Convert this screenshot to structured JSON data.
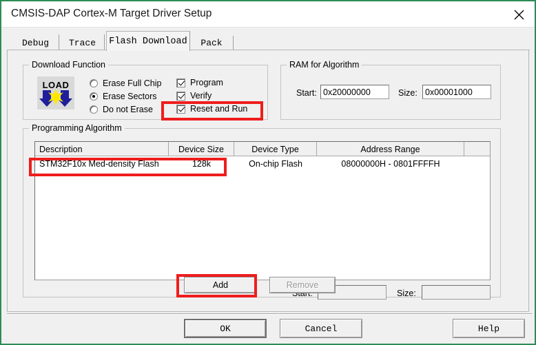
{
  "window": {
    "title": "CMSIS-DAP Cortex-M Target Driver Setup",
    "close_icon": "close-icon",
    "border_color": "#2e8b57"
  },
  "tabs": [
    {
      "label": "Debug",
      "active": false
    },
    {
      "label": "Trace",
      "active": false
    },
    {
      "label": "Flash Download",
      "active": true
    },
    {
      "label": "Pack",
      "active": false
    }
  ],
  "download_function": {
    "group_title": "Download Function",
    "icon": "load-icon",
    "erase_mode_selected": "Erase Sectors",
    "radios": [
      {
        "label": "Erase Full Chip",
        "checked": false
      },
      {
        "label": "Erase Sectors",
        "checked": true
      },
      {
        "label": "Do not Erase",
        "checked": false
      }
    ],
    "checkboxes": [
      {
        "label": "Program",
        "checked": true
      },
      {
        "label": "Verify",
        "checked": true
      },
      {
        "label": "Reset and Run",
        "checked": true
      }
    ]
  },
  "ram_for_algorithm": {
    "group_title": "RAM for Algorithm",
    "start_label": "Start:",
    "start_value": "0x20000000",
    "size_label": "Size:",
    "size_value": "0x00001000"
  },
  "programming_algorithm": {
    "group_title": "Programming Algorithm",
    "columns": [
      "Description",
      "Device Size",
      "Device Type",
      "Address Range",
      ""
    ],
    "rows": [
      {
        "description": "STM32F10x Med-density Flash",
        "device_size": "128k",
        "device_type": "On-chip Flash",
        "address_range": "08000000H - 0801FFFFH",
        "extra": ""
      }
    ],
    "start_label": "Start:",
    "start_value": "",
    "size_label": "Size:",
    "size_value": "",
    "add_label": "Add",
    "remove_label": "Remove",
    "remove_disabled": true
  },
  "dialog_buttons": {
    "ok": "OK",
    "cancel": "Cancel",
    "help": "Help"
  },
  "annotations": {
    "highlight_color": "#ef1d1d",
    "boxes": [
      {
        "name": "reset-and-run-highlight"
      },
      {
        "name": "algorithm-row-highlight"
      },
      {
        "name": "add-button-highlight"
      }
    ]
  }
}
